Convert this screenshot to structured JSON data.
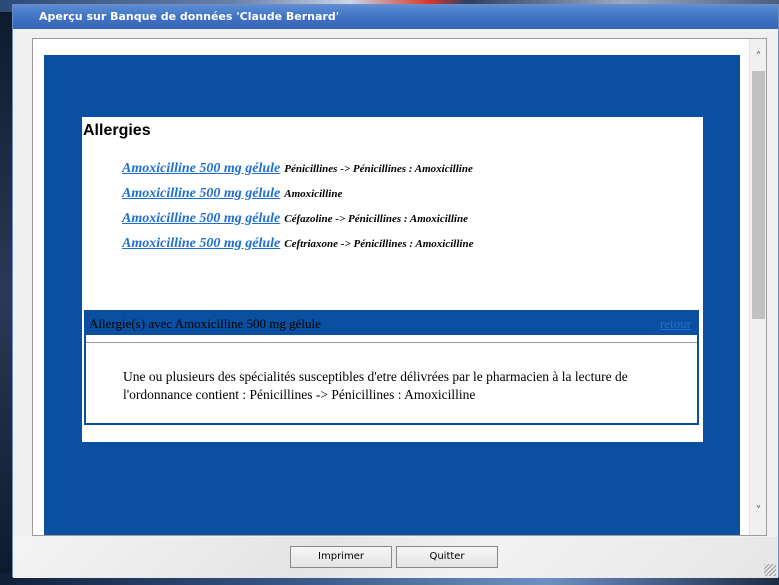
{
  "window": {
    "title": "Aperçu sur Banque de données 'Claude Bernard'"
  },
  "content": {
    "section_title": "Allergies",
    "allergies": [
      {
        "drug": "Amoxicilline 500 mg gélule",
        "detail": "Pénicillines -> Pénicillines : Amoxicilline"
      },
      {
        "drug": "Amoxicilline 500 mg gélule",
        "detail": "Amoxicilline"
      },
      {
        "drug": "Amoxicilline 500 mg gélule",
        "detail": "Céfazoline -> Pénicillines : Amoxicilline"
      },
      {
        "drug": "Amoxicilline 500 mg gélule",
        "detail": "Ceftriaxone -> Pénicillines : Amoxicilline"
      }
    ],
    "detail_box": {
      "title": "Allergie(s) avec Amoxicilline 500 mg gélule",
      "return_link": "retour",
      "text": "Une ou plusieurs des spécialités susceptibles d'etre délivrées par le pharmacien à la lecture de l'ordonnance contient : Pénicillines -> Pénicillines : Amoxicilline"
    }
  },
  "footer": {
    "print_label": "Imprimer",
    "quit_label": "Quitter"
  },
  "scrollbar": {
    "up_icon": "chevron-up-icon",
    "down_icon": "chevron-down-icon"
  },
  "colors": {
    "titlebar": "#3e6fc0",
    "viewport_bg": "#0a4fa0",
    "link": "#1f6fce"
  }
}
